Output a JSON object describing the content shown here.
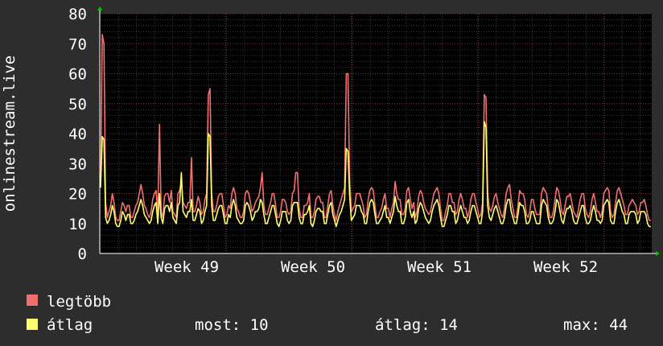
{
  "chart_data": {
    "type": "line",
    "ylabel": "onlinestream.live",
    "ylim": [
      0,
      80
    ],
    "y_ticks": [
      0,
      10,
      20,
      30,
      40,
      50,
      60,
      70,
      80
    ],
    "x_tick_labels": [
      "Week 49",
      "Week 50",
      "Week 51",
      "Week 52"
    ],
    "grid": true,
    "series": [
      {
        "name": "legtöbb",
        "color": "#f07070",
        "values": [
          24,
          73,
          70,
          17,
          12,
          14,
          16,
          20,
          17,
          12,
          11,
          11,
          14,
          17,
          16,
          14,
          16,
          16,
          12,
          12,
          14,
          16,
          17,
          20,
          23,
          20,
          16,
          15,
          13,
          12,
          14,
          18,
          20,
          21,
          13,
          43,
          14,
          12,
          19,
          20,
          20,
          17,
          21,
          14,
          13,
          12,
          20,
          21,
          24,
          17,
          16,
          15,
          17,
          17,
          32,
          14,
          14,
          16,
          19,
          17,
          13,
          14,
          18,
          20,
          53,
          55,
          20,
          14,
          14,
          16,
          19,
          20,
          20,
          16,
          12,
          13,
          16,
          15,
          20,
          22,
          20,
          15,
          14,
          12,
          12,
          14,
          20,
          21,
          20,
          17,
          14,
          15,
          17,
          18,
          19,
          22,
          27,
          16,
          13,
          13,
          15,
          17,
          20,
          20,
          16,
          12,
          12,
          14,
          18,
          18,
          17,
          14,
          13,
          14,
          20,
          21,
          27,
          27,
          15,
          12,
          12,
          16,
          16,
          17,
          20,
          12,
          12,
          14,
          18,
          19,
          19,
          17,
          17,
          12,
          12,
          16,
          20,
          21,
          16,
          13,
          11,
          14,
          16,
          18,
          20,
          22,
          60,
          60,
          24,
          14,
          15,
          16,
          20,
          20,
          20,
          18,
          16,
          12,
          13,
          18,
          21,
          22,
          21,
          16,
          12,
          12,
          14,
          15,
          18,
          20,
          15,
          15,
          12,
          15,
          17,
          24,
          20,
          18,
          18,
          13,
          13,
          15,
          21,
          22,
          18,
          15,
          17,
          12,
          14,
          19,
          21,
          20,
          17,
          15,
          14,
          13,
          14,
          17,
          20,
          21,
          22,
          20,
          15,
          11,
          11,
          14,
          16,
          20,
          20,
          17,
          17,
          13,
          14,
          18,
          20,
          18,
          15,
          15,
          12,
          14,
          18,
          20,
          20,
          17,
          15,
          12,
          13,
          17,
          53,
          52,
          20,
          15,
          14,
          16,
          19,
          20,
          17,
          15,
          13,
          12,
          15,
          20,
          22,
          23,
          18,
          15,
          12,
          12,
          16,
          21,
          20,
          20,
          18,
          13,
          12,
          14,
          18,
          18,
          15,
          13,
          13,
          13,
          20,
          22,
          21,
          20,
          15,
          12,
          12,
          14,
          18,
          22,
          21,
          18,
          14,
          13,
          16,
          19,
          19,
          20,
          17,
          14,
          13,
          12,
          15,
          18,
          20,
          20,
          15,
          13,
          12,
          14,
          18,
          20,
          17,
          14,
          14,
          12,
          14,
          20,
          21,
          22,
          21,
          14,
          12,
          13,
          17,
          21,
          22,
          20,
          18,
          16,
          13,
          13,
          16,
          17,
          18,
          17,
          16,
          13,
          14,
          17,
          17,
          18,
          16,
          13,
          11,
          11
        ]
      },
      {
        "name": "átlag",
        "color": "#ffff6e",
        "values": [
          22,
          39,
          38,
          12,
          10,
          11,
          13,
          16,
          14,
          10,
          9,
          9,
          11,
          14,
          13,
          11,
          13,
          13,
          10,
          10,
          11,
          13,
          14,
          16,
          18,
          16,
          13,
          12,
          11,
          10,
          11,
          14,
          16,
          17,
          10,
          20,
          12,
          10,
          15,
          16,
          16,
          14,
          17,
          12,
          11,
          10,
          16,
          17,
          27,
          14,
          13,
          12,
          14,
          14,
          18,
          11,
          11,
          13,
          15,
          14,
          10,
          11,
          14,
          16,
          40,
          39,
          16,
          11,
          11,
          13,
          15,
          16,
          16,
          13,
          10,
          10,
          13,
          12,
          16,
          18,
          16,
          12,
          11,
          10,
          10,
          11,
          16,
          17,
          16,
          14,
          11,
          12,
          14,
          14,
          15,
          18,
          17,
          13,
          10,
          10,
          12,
          14,
          16,
          16,
          13,
          10,
          9,
          11,
          14,
          14,
          14,
          11,
          10,
          11,
          16,
          17,
          17,
          17,
          12,
          10,
          10,
          13,
          13,
          14,
          16,
          10,
          9,
          11,
          14,
          15,
          15,
          14,
          14,
          10,
          10,
          13,
          16,
          17,
          13,
          11,
          9,
          11,
          13,
          14,
          16,
          18,
          35,
          34,
          19,
          11,
          12,
          13,
          16,
          16,
          16,
          14,
          13,
          10,
          10,
          14,
          17,
          18,
          17,
          13,
          10,
          10,
          11,
          12,
          14,
          16,
          12,
          12,
          10,
          12,
          14,
          19,
          16,
          14,
          14,
          10,
          10,
          12,
          17,
          18,
          14,
          12,
          14,
          10,
          11,
          15,
          17,
          16,
          14,
          12,
          11,
          10,
          11,
          14,
          16,
          17,
          18,
          16,
          12,
          9,
          9,
          11,
          13,
          16,
          16,
          14,
          14,
          10,
          11,
          14,
          16,
          14,
          12,
          12,
          10,
          11,
          14,
          16,
          16,
          14,
          12,
          10,
          10,
          14,
          44,
          42,
          16,
          12,
          11,
          13,
          15,
          16,
          14,
          12,
          10,
          10,
          12,
          16,
          18,
          18,
          14,
          12,
          10,
          10,
          13,
          17,
          16,
          16,
          14,
          10,
          10,
          11,
          14,
          14,
          12,
          10,
          10,
          10,
          16,
          18,
          17,
          16,
          12,
          10,
          10,
          11,
          14,
          18,
          17,
          14,
          11,
          10,
          13,
          15,
          15,
          16,
          14,
          11,
          10,
          10,
          12,
          14,
          16,
          16,
          12,
          10,
          10,
          11,
          14,
          16,
          14,
          11,
          11,
          10,
          11,
          16,
          17,
          18,
          17,
          11,
          10,
          10,
          14,
          17,
          18,
          16,
          14,
          13,
          10,
          10,
          13,
          14,
          14,
          14,
          13,
          10,
          11,
          14,
          14,
          14,
          13,
          10,
          9,
          9
        ]
      }
    ]
  },
  "legend": {
    "items": [
      {
        "label": "legtöbb",
        "color": "#f07070"
      },
      {
        "label": "átlag",
        "color": "#ffff6e"
      }
    ],
    "stats": {
      "most": "most: 10",
      "atlag": "átlag: 14",
      "max": "max: 44"
    }
  }
}
